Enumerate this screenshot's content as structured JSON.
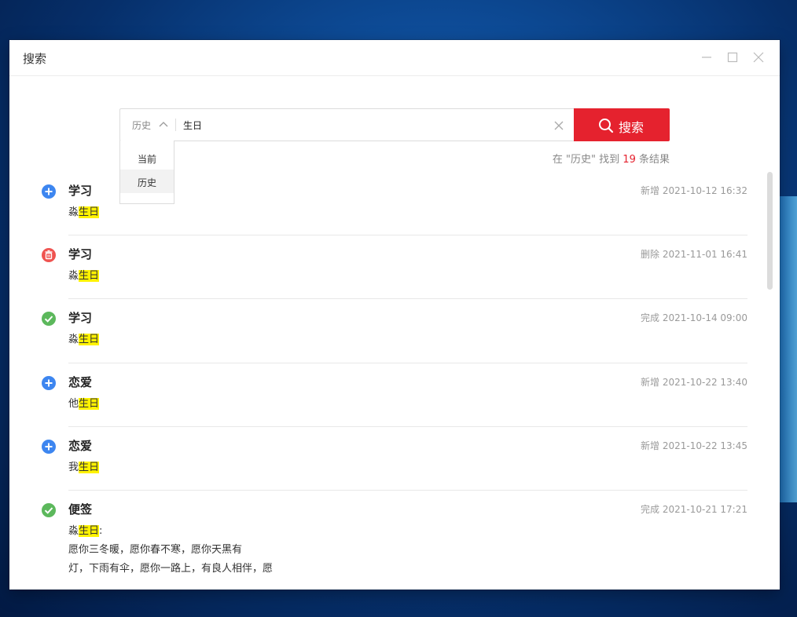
{
  "window": {
    "title": "搜索"
  },
  "search": {
    "scope_label": "历史",
    "query": "生日",
    "button_label": "搜索",
    "dropdown": [
      "当前",
      "历史"
    ],
    "result_prefix": "在 \"历史\" 找到",
    "result_count": "19",
    "result_suffix": "条结果"
  },
  "results": [
    {
      "status": "add",
      "status_icon": "plus-circle-icon",
      "category": "学习",
      "action": "新增",
      "time": "2021-10-12 16:32",
      "lines": [
        {
          "pre": "淼",
          "hl": "生日",
          "post": ""
        }
      ]
    },
    {
      "status": "delete",
      "status_icon": "trash-icon",
      "category": "学习",
      "action": "删除",
      "time": "2021-11-01 16:41",
      "lines": [
        {
          "pre": "淼",
          "hl": "生日",
          "post": ""
        }
      ]
    },
    {
      "status": "done",
      "status_icon": "check-circle-icon",
      "category": "学习",
      "action": "完成",
      "time": "2021-10-14 09:00",
      "lines": [
        {
          "pre": "淼",
          "hl": "生日",
          "post": ""
        }
      ]
    },
    {
      "status": "add",
      "status_icon": "plus-circle-icon",
      "category": "恋爱",
      "action": "新增",
      "time": "2021-10-22 13:40",
      "lines": [
        {
          "pre": "他",
          "hl": "生日",
          "post": ""
        }
      ]
    },
    {
      "status": "add",
      "status_icon": "plus-circle-icon",
      "category": "恋爱",
      "action": "新增",
      "time": "2021-10-22 13:45",
      "lines": [
        {
          "pre": "我",
          "hl": "生日",
          "post": ""
        }
      ]
    },
    {
      "status": "done",
      "status_icon": "check-circle-icon",
      "category": "便签",
      "action": "完成",
      "time": "2021-10-21 17:21",
      "lines": [
        {
          "pre": "淼",
          "hl": "生日",
          "post": ":"
        },
        {
          "pre": "愿你三冬暖，愿你春不寒，愿你天黑有",
          "hl": "",
          "post": ""
        },
        {
          "pre": "灯，下雨有伞，愿你一路上，有良人相伴，愿",
          "hl": "",
          "post": ""
        }
      ]
    }
  ],
  "colors": {
    "accent": "#e5222e",
    "add": "#3d86f0",
    "delete": "#ef5350",
    "done": "#5cb85c",
    "highlight": "#fff200"
  }
}
